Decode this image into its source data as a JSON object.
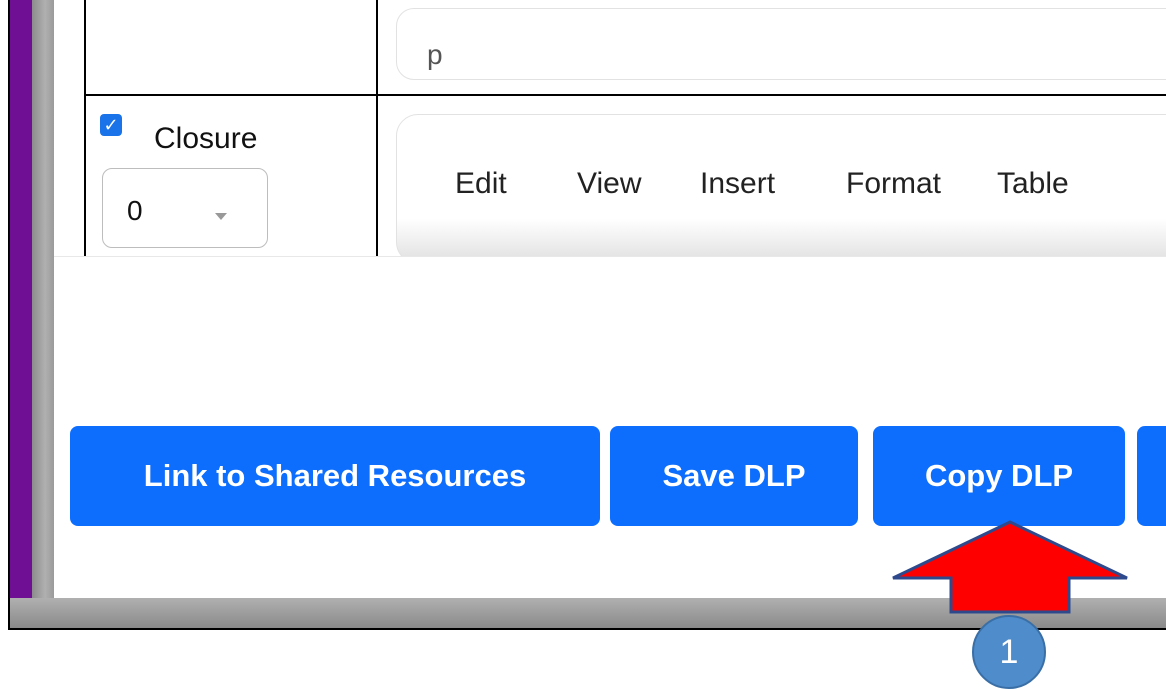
{
  "table": {
    "top_row_field_value": "p",
    "closure": {
      "checkbox_checked": true,
      "label": "Closure",
      "select_value": "0"
    },
    "editor_menu": [
      "Edit",
      "View",
      "Insert",
      "Format",
      "Table"
    ]
  },
  "actions": {
    "link_shared_label": "Link to Shared Resources",
    "save_label": "Save DLP",
    "copy_label": "Copy DLP"
  },
  "annotation": {
    "step_number": "1",
    "arrow_color": "#ff0000",
    "badge_color": "#4f8ccc"
  },
  "colors": {
    "button_bg": "#0d6efd",
    "sidebar_purple": "#6f0f94",
    "checkbox_blue": "#1a73e8"
  }
}
